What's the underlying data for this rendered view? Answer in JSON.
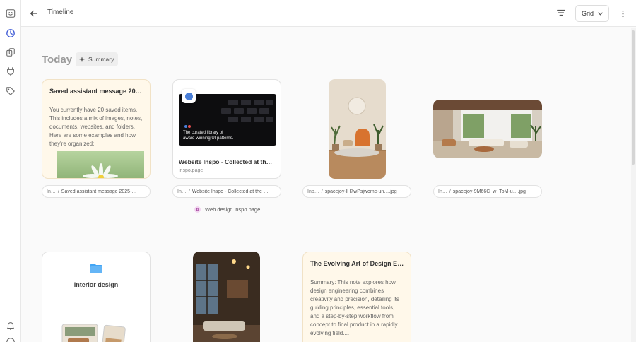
{
  "header": {
    "title": "Timeline",
    "view_mode": "Grid"
  },
  "section": {
    "title": "Today",
    "summary_label": "Summary"
  },
  "cards": {
    "saved_note": {
      "title": "Saved assistant message 2025-…",
      "body": "You currently have 20 saved items. This includes a mix of images, notes, documents, websites, and folders. Here are some examples and how they're organized:"
    },
    "website": {
      "title": "Website Inspo - Collected at the …",
      "domain": "inspo.page",
      "thumb_text": "The curated library of award-winning UI patterns."
    },
    "folder": {
      "label": "Interior design"
    },
    "design_note": {
      "title": "The Evolving Art of Design Engi…",
      "body": "Summary: This note explores how design engineering combines creativity and precision, detailing its guiding principles, essential tools, and a step-by-step workflow from concept to final product in a rapidly evolving field...."
    }
  },
  "chips": [
    {
      "folder": "In…",
      "name": "Saved assistant message 2025-…"
    },
    {
      "folder": "In…",
      "name": "Website Inspo - Collected at the …"
    },
    {
      "folder": "Inb…",
      "name": "spacejoy-lH7wPsjwomc-un…",
      "ext": ".jpg"
    },
    {
      "folder": "In…",
      "name": "spacejoy-9M66C_w_ToM-u…",
      "ext": ".jpg"
    }
  ],
  "tag": {
    "initial": "B",
    "label": "Web design inspo page"
  },
  "colors": {
    "note_bg": "#fff8ea",
    "accent_blue": "#4a7fd8",
    "folder_blue": "#42a5f5"
  }
}
